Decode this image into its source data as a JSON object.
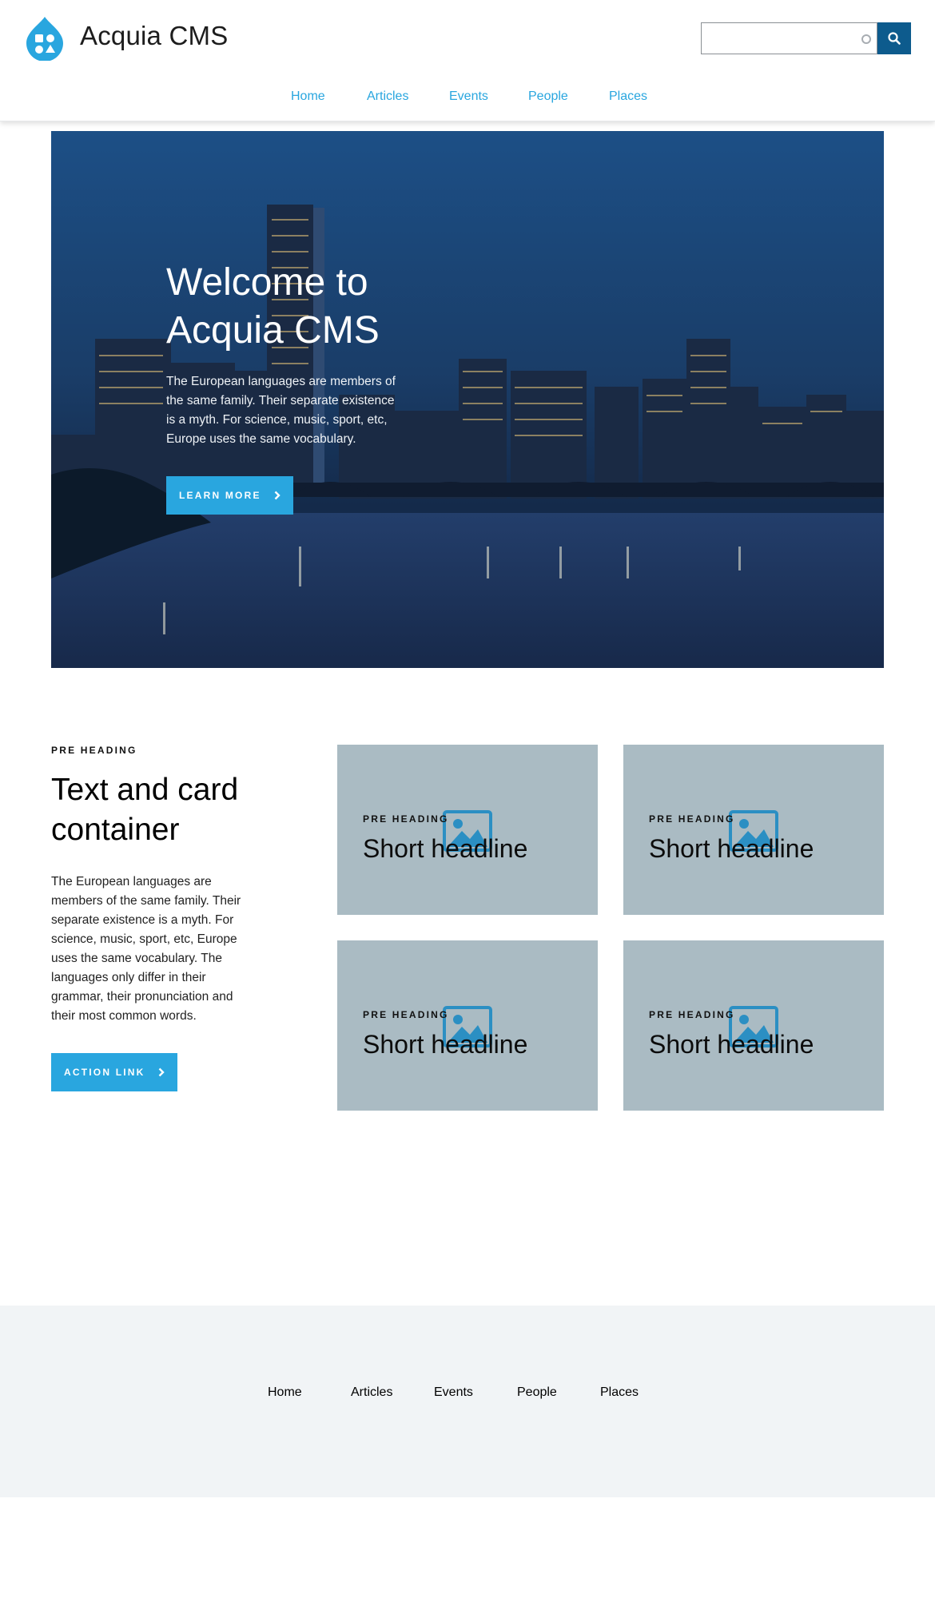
{
  "site": {
    "name": "Acquia CMS"
  },
  "colors": {
    "accent": "#29a6df",
    "search_button": "#0d5b8d",
    "card_bg": "#aabbc3",
    "footer_bg": "#f1f4f6"
  },
  "search": {
    "placeholder": "",
    "button_icon": "search-icon"
  },
  "nav": [
    "Home",
    "Articles",
    "Events",
    "People",
    "Places"
  ],
  "hero": {
    "title": "Welcome to Acquia CMS",
    "body": "The European languages are members of the same family. Their separate existence is a myth. For science, music, sport, etc, Europe uses the same vocabulary.",
    "button": "LEARN MORE"
  },
  "text_card": {
    "pre_heading": "PRE HEADING",
    "title": "Text and card container",
    "body": "The European languages are members of the same family. Their separate existence is a myth. For science, music, sport, etc, Europe uses the same vocabulary. The languages only differ in their grammar, their pronunciation and their most common words.",
    "button": "ACTION LINK",
    "cards": [
      {
        "pre_heading": "PRE HEADING",
        "title": "Short headline"
      },
      {
        "pre_heading": "PRE HEADING",
        "title": "Short headline"
      },
      {
        "pre_heading": "PRE HEADING",
        "title": "Short headline"
      },
      {
        "pre_heading": "PRE HEADING",
        "title": "Short headline"
      }
    ]
  },
  "footer_nav": [
    "Home",
    "Articles",
    "Events",
    "People",
    "Places"
  ]
}
